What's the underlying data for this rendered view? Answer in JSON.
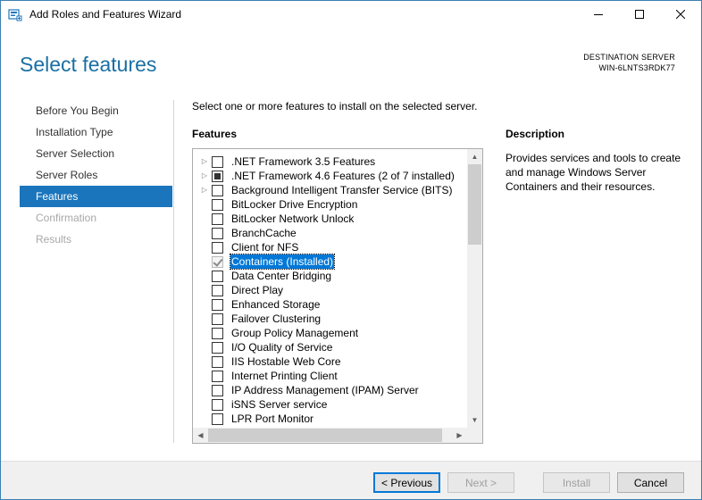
{
  "window": {
    "title": "Add Roles and Features Wizard",
    "minimize_icon": "minimize-icon",
    "maximize_icon": "maximize-icon",
    "close_icon": "close-icon"
  },
  "header": {
    "page_title": "Select features",
    "destination_label": "DESTINATION SERVER",
    "destination_server": "WIN-6LNTS3RDK77"
  },
  "nav": {
    "items": [
      {
        "label": "Before You Begin",
        "state": "normal"
      },
      {
        "label": "Installation Type",
        "state": "normal"
      },
      {
        "label": "Server Selection",
        "state": "normal"
      },
      {
        "label": "Server Roles",
        "state": "normal"
      },
      {
        "label": "Features",
        "state": "active"
      },
      {
        "label": "Confirmation",
        "state": "disabled"
      },
      {
        "label": "Results",
        "state": "disabled"
      }
    ]
  },
  "main": {
    "instruction": "Select one or more features to install on the selected server.",
    "features_heading": "Features",
    "description_heading": "Description",
    "description_text": "Provides services and tools to create and manage Windows Server Containers and their resources.",
    "features": [
      {
        "label": ".NET Framework 3.5 Features",
        "expandable": true,
        "check": "unchecked",
        "selected": false
      },
      {
        "label": ".NET Framework 4.6 Features (2 of 7 installed)",
        "expandable": true,
        "check": "partial",
        "selected": false
      },
      {
        "label": "Background Intelligent Transfer Service (BITS)",
        "expandable": true,
        "check": "unchecked",
        "selected": false
      },
      {
        "label": "BitLocker Drive Encryption",
        "expandable": false,
        "check": "unchecked",
        "selected": false
      },
      {
        "label": "BitLocker Network Unlock",
        "expandable": false,
        "check": "unchecked",
        "selected": false
      },
      {
        "label": "BranchCache",
        "expandable": false,
        "check": "unchecked",
        "selected": false
      },
      {
        "label": "Client for NFS",
        "expandable": false,
        "check": "unchecked",
        "selected": false
      },
      {
        "label": "Containers (Installed)",
        "expandable": false,
        "check": "installed",
        "selected": true
      },
      {
        "label": "Data Center Bridging",
        "expandable": false,
        "check": "unchecked",
        "selected": false
      },
      {
        "label": "Direct Play",
        "expandable": false,
        "check": "unchecked",
        "selected": false
      },
      {
        "label": "Enhanced Storage",
        "expandable": false,
        "check": "unchecked",
        "selected": false
      },
      {
        "label": "Failover Clustering",
        "expandable": false,
        "check": "unchecked",
        "selected": false
      },
      {
        "label": "Group Policy Management",
        "expandable": false,
        "check": "unchecked",
        "selected": false
      },
      {
        "label": "I/O Quality of Service",
        "expandable": false,
        "check": "unchecked",
        "selected": false
      },
      {
        "label": "IIS Hostable Web Core",
        "expandable": false,
        "check": "unchecked",
        "selected": false
      },
      {
        "label": "Internet Printing Client",
        "expandable": false,
        "check": "unchecked",
        "selected": false
      },
      {
        "label": "IP Address Management (IPAM) Server",
        "expandable": false,
        "check": "unchecked",
        "selected": false
      },
      {
        "label": "iSNS Server service",
        "expandable": false,
        "check": "unchecked",
        "selected": false
      },
      {
        "label": "LPR Port Monitor",
        "expandable": false,
        "check": "unchecked",
        "selected": false
      }
    ]
  },
  "footer": {
    "previous_label": "< Previous",
    "next_label": "Next >",
    "install_label": "Install",
    "cancel_label": "Cancel"
  },
  "colors": {
    "accent": "#1b75bc",
    "title_blue": "#1a6fa3",
    "selection": "#0078d7"
  }
}
